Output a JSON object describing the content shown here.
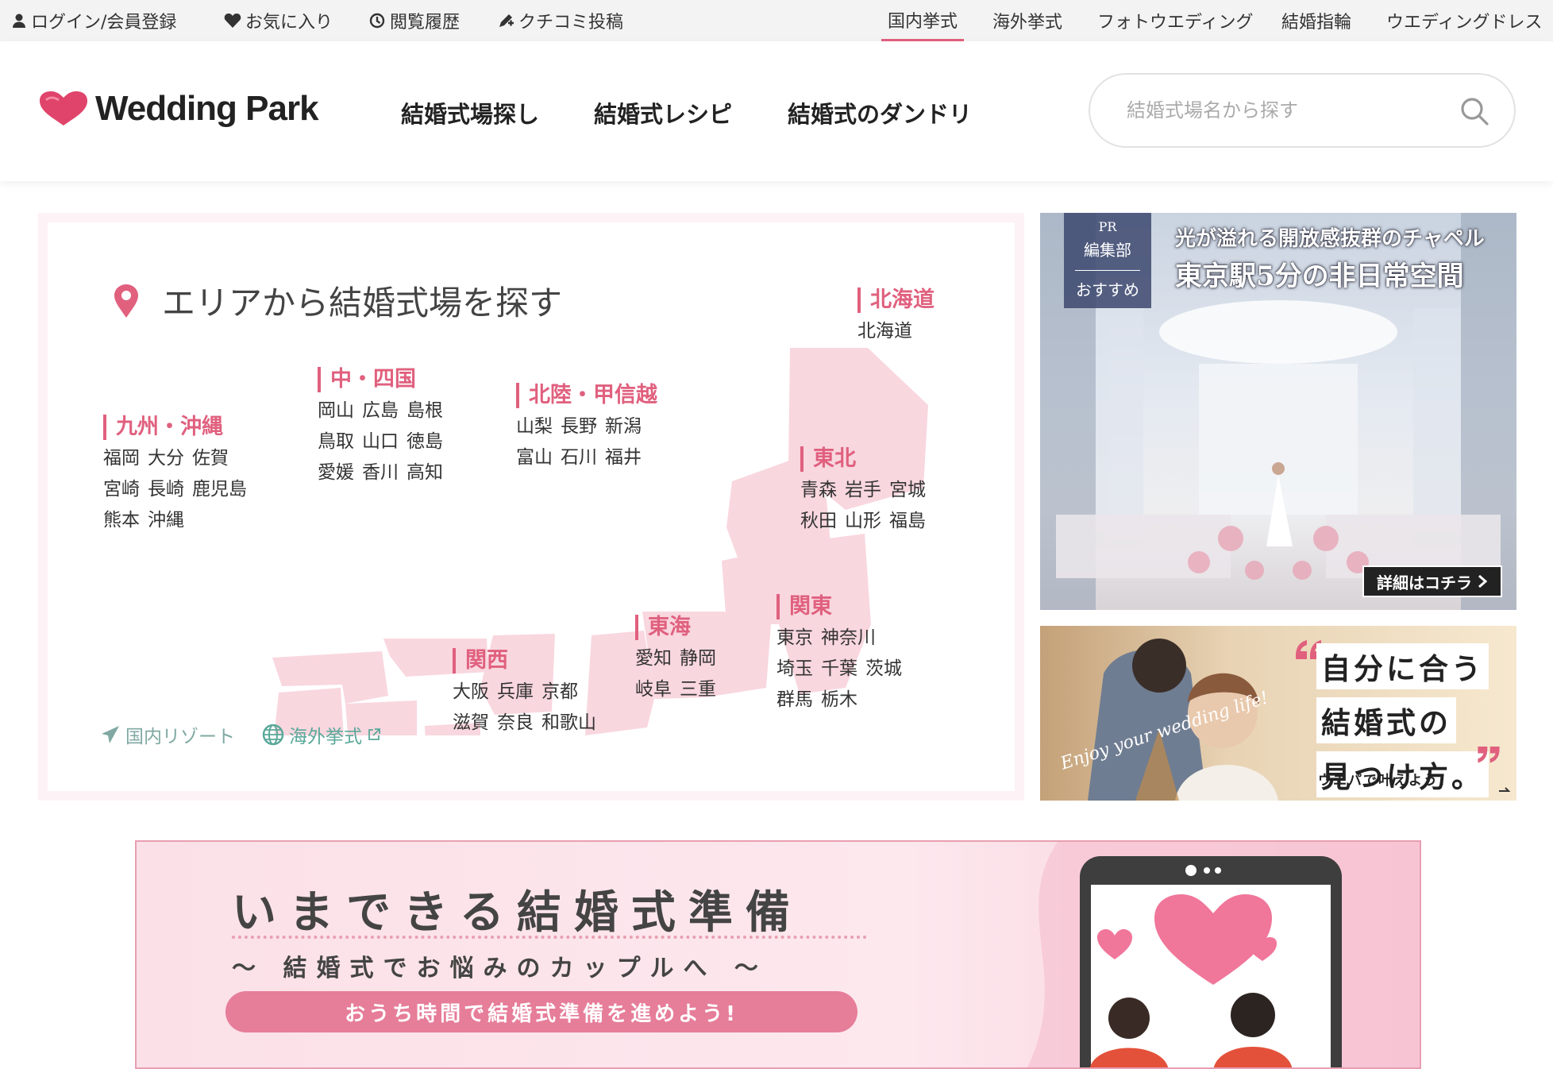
{
  "topbar": {
    "left_links": [
      {
        "label": "ログイン/会員登録",
        "icon": "user-icon"
      },
      {
        "label": "お気に入り",
        "icon": "heart-icon"
      },
      {
        "label": "閲覧履歴",
        "icon": "history-icon"
      },
      {
        "label": "クチコミ投稿",
        "icon": "pen-icon"
      }
    ],
    "right_links": [
      {
        "label": "国内挙式",
        "active": true
      },
      {
        "label": "海外挙式"
      },
      {
        "label": "フォトウエディング"
      },
      {
        "label": "結婚指輪"
      },
      {
        "label": "ウエディングドレス"
      }
    ]
  },
  "header": {
    "logo_text": "Wedding Park",
    "nav": [
      "結婚式場探し",
      "結婚式レシピ",
      "結婚式のダンドリ"
    ],
    "search_placeholder": "結婚式場名から探す"
  },
  "area": {
    "title": "エリアから結婚式場を探す",
    "regions": [
      {
        "name": "北海道",
        "rows": [
          [
            "北海道"
          ]
        ]
      },
      {
        "name": "東北",
        "rows": [
          [
            "青森",
            "岩手",
            "宮城"
          ],
          [
            "秋田",
            "山形",
            "福島"
          ]
        ]
      },
      {
        "name": "関東",
        "rows": [
          [
            "東京",
            "神奈川"
          ],
          [
            "埼玉",
            "千葉",
            "茨城"
          ],
          [
            "群馬",
            "栃木"
          ]
        ]
      },
      {
        "name": "北陸・甲信越",
        "rows": [
          [
            "山梨",
            "長野",
            "新潟"
          ],
          [
            "富山",
            "石川",
            "福井"
          ]
        ]
      },
      {
        "name": "東海",
        "rows": [
          [
            "愛知",
            "静岡"
          ],
          [
            "岐阜",
            "三重"
          ]
        ]
      },
      {
        "name": "関西",
        "rows": [
          [
            "大阪",
            "兵庫",
            "京都"
          ],
          [
            "滋賀",
            "奈良",
            "和歌山"
          ]
        ]
      },
      {
        "name": "中・四国",
        "rows": [
          [
            "岡山",
            "広島",
            "島根"
          ],
          [
            "鳥取",
            "山口",
            "徳島"
          ],
          [
            "愛媛",
            "香川",
            "高知"
          ]
        ]
      },
      {
        "name": "九州・沖縄",
        "rows": [
          [
            "福岡",
            "大分",
            "佐賀"
          ],
          [
            "宮崎",
            "長崎",
            "鹿児島"
          ],
          [
            "熊本",
            "沖縄"
          ]
        ]
      }
    ],
    "extra_links": [
      {
        "label": "国内リゾート",
        "icon": "airplane-icon"
      },
      {
        "label": "海外挙式",
        "icon": "globe-icon"
      }
    ]
  },
  "banners": {
    "pr": {
      "badge_pr": "PR",
      "badge_line1": "編集部",
      "badge_line2": "おすすめ",
      "subtitle": "光が溢れる開放感抜群のチャペル",
      "title": "東京駅5分の非日常空間",
      "cta": "詳細はコチラ"
    },
    "find": {
      "lines": [
        "自分に合う",
        "結婚式の",
        "見つけ方。"
      ],
      "sub": "ウエパで叶えよう！",
      "script": "Enjoy your wedding life!"
    },
    "prep": {
      "title": "いまできる結婚式準備",
      "subtitle": "〜 結婚式でお悩みのカップルへ 〜",
      "pill": "おうち時間で結婚式準備を進めよう!"
    }
  },
  "colors": {
    "accent": "#e0607e",
    "map": "#f9d7df",
    "teal": "#5aa89a"
  }
}
